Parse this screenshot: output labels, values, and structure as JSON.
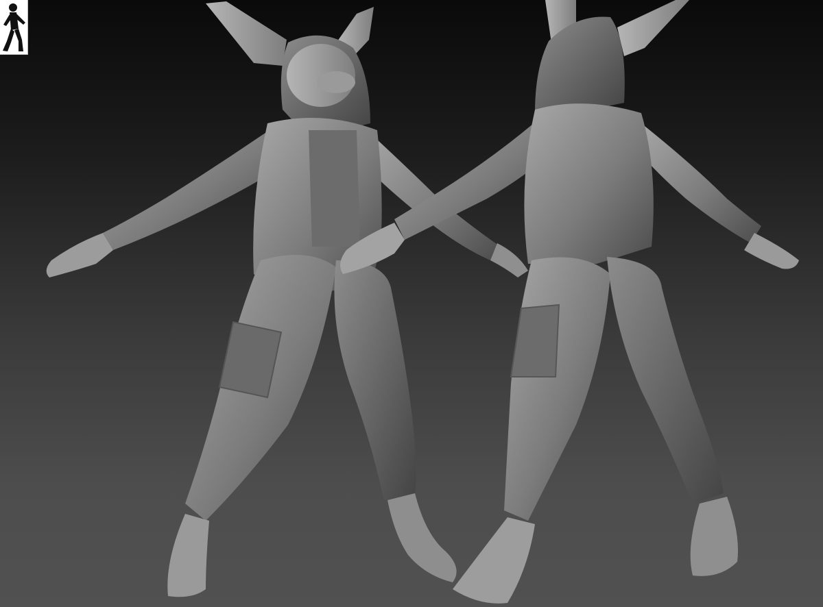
{
  "viewport": {
    "background_top": "#0a0a0a",
    "background_bottom": "#515151"
  },
  "nav_gizmo": {
    "icon": "walking-figure-icon",
    "background": "#ffffff"
  },
  "model": {
    "material_base": "#7a7a7a",
    "material_light": "#a5a5a5",
    "material_shadow": "#454545",
    "views": [
      "front-three-quarter",
      "back-three-quarter"
    ]
  }
}
